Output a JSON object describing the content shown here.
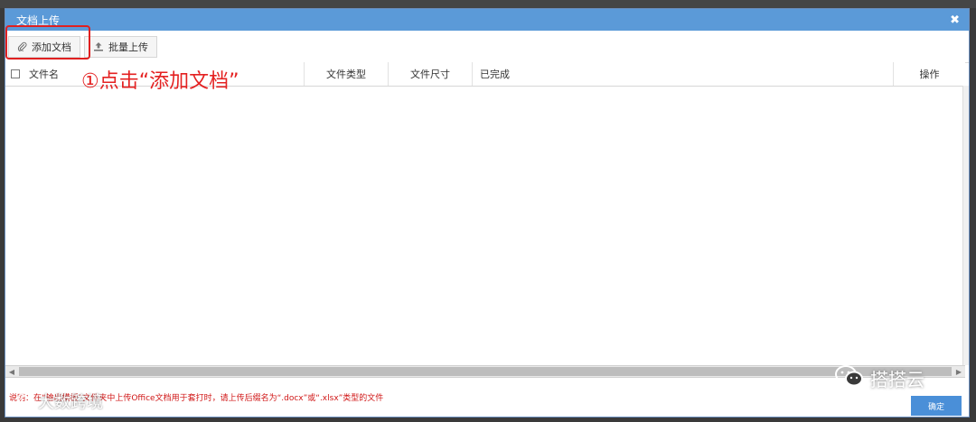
{
  "dialog": {
    "title": "文档上传",
    "close_glyph": "✖"
  },
  "toolbar": {
    "add_label": "添加文档",
    "batch_label": "批量上传"
  },
  "table": {
    "headers": [
      "文件名",
      "文件类型",
      "文件尺寸",
      "已完成",
      "操作"
    ]
  },
  "annotation": "①点击“添加文档”",
  "footer": {
    "tip": "说明：在“输出模板”文件夹中上传Office文档用于套打时，请上传后缀名为“.docx”或“.xlsx”类型的文件",
    "ok_label": "确定"
  },
  "watermarks": {
    "wechat": "搭搭云",
    "brand": "大数跨境"
  },
  "colors": {
    "titlebar": "#5b9ad8",
    "accent_red": "#e02020",
    "ok_button": "#4a8fd8"
  }
}
